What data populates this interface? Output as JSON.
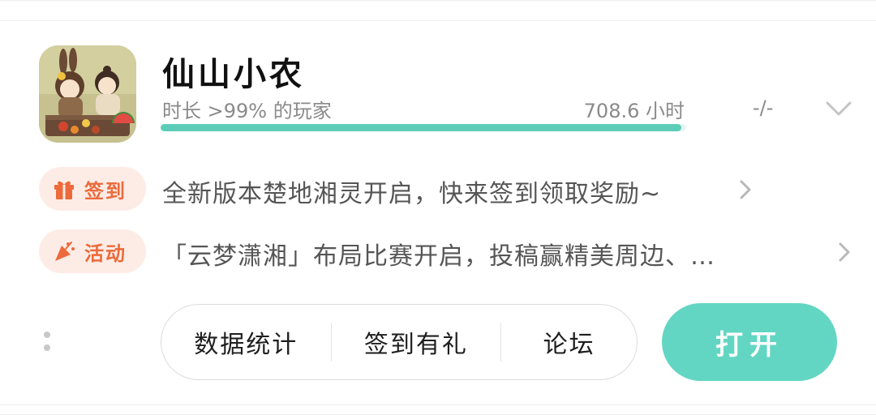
{
  "app": {
    "title": "仙山小农",
    "playtime_label": "时长 >99% 的玩家",
    "playtime_hours": "708.6 小时",
    "rating": "-/-",
    "playtime_percentile": 0.99
  },
  "rows": [
    {
      "badge_label": "签到",
      "badge_icon": "gift-icon",
      "text": "全新版本楚地湘灵开启，快来签到领取奖励~"
    },
    {
      "badge_label": "活动",
      "badge_icon": "party-horn-icon",
      "text": "「云梦潇湘」布局比赛开启，投稿赢精美周边、…"
    }
  ],
  "actions": {
    "stats_label": "数据统计",
    "checkin_label": "签到有礼",
    "forum_label": "论坛",
    "open_label": "打开"
  },
  "colors": {
    "accent": "#63d6c3",
    "progress": "#5dcdb9",
    "badge_bg": "#fdece6",
    "badge_text": "#ec6a3b"
  }
}
